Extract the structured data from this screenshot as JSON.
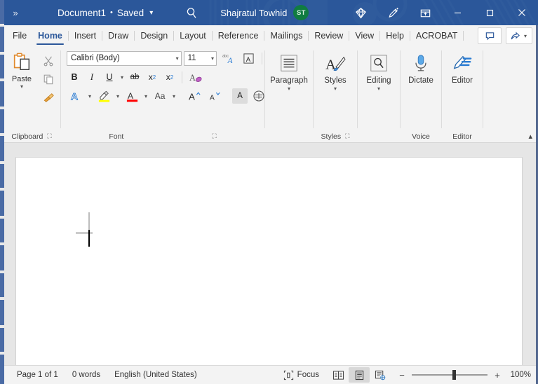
{
  "titlebar": {
    "expand_icon": "chevron-double-right-icon",
    "document_name": "Document1",
    "separator": "•",
    "saved_state": "Saved",
    "dropdown_icon": "chevron-down-icon",
    "search_icon": "search-icon",
    "user_name": "Shajratul Towhid",
    "avatar_initials": "ST",
    "avatar_color": "#107c41",
    "copilot_icon": "diamond-icon",
    "designer_icon": "pen-sparkle-icon",
    "ribbon_display_icon": "ribbon-display-options-icon",
    "minimize_icon": "minimize-icon",
    "maximize_icon": "maximize-icon",
    "close_icon": "close-icon",
    "bg_color": "#2b579a"
  },
  "tabs": [
    {
      "label": "File",
      "active": false
    },
    {
      "label": "Home",
      "active": true
    },
    {
      "label": "Insert",
      "active": false
    },
    {
      "label": "Draw",
      "active": false
    },
    {
      "label": "Design",
      "active": false
    },
    {
      "label": "Layout",
      "active": false
    },
    {
      "label": "Reference",
      "active": false
    },
    {
      "label": "Mailings",
      "active": false
    },
    {
      "label": "Review",
      "active": false
    },
    {
      "label": "View",
      "active": false
    },
    {
      "label": "Help",
      "active": false
    },
    {
      "label": "ACROBAT",
      "active": false
    }
  ],
  "tabbar_right": {
    "comments_icon": "comment-icon",
    "share_icon": "share-icon",
    "share_dropdown_icon": "chevron-down-icon"
  },
  "ribbon": {
    "active_tab_accent": "#2b579a",
    "clipboard": {
      "group_label": "Clipboard",
      "launcher_icon": "dialog-launcher-icon",
      "paste_label": "Paste",
      "paste_dropdown_icon": "chevron-down-icon",
      "cut_icon": "scissors-icon",
      "copy_icon": "copy-icon",
      "format_painter_icon": "format-painter-icon"
    },
    "font": {
      "group_label": "Font",
      "launcher_icon": "dialog-launcher-icon",
      "font_name": "Calibri (Body)",
      "font_size": "11",
      "font_name_dropdown_icon": "chevron-down-icon",
      "font_size_dropdown_icon": "chevron-down-icon",
      "phonetic_guide_icon": "phonetic-guide-icon",
      "character_border_icon": "character-border-icon",
      "bold_label": "B",
      "italic_label": "I",
      "underline_label": "U",
      "underline_dropdown_icon": "chevron-down-icon",
      "strikethrough_label": "ab",
      "subscript_label": "x",
      "subscript_sub": "2",
      "superscript_label": "x",
      "superscript_sup": "2",
      "clear_formatting_icon": "clear-formatting-icon",
      "text_effects_label": "A",
      "text_effects_dropdown_icon": "chevron-down-icon",
      "highlight_icon": "highlighter-icon",
      "highlight_color": "#ffff00",
      "highlight_dropdown_icon": "chevron-down-icon",
      "font_color_label": "A",
      "font_color": "#ff0000",
      "font_color_dropdown_icon": "chevron-down-icon",
      "change_case_label": "Aa",
      "change_case_dropdown_icon": "chevron-down-icon",
      "grow_font_label": "A",
      "shrink_font_label": "A",
      "text_highlight_label": "A",
      "character_shading_icon": "character-shading-icon"
    },
    "paragraph": {
      "label": "Paragraph",
      "icon": "paragraph-lines-icon",
      "dropdown_icon": "chevron-down-icon"
    },
    "styles": {
      "group_label": "Styles",
      "label": "Styles",
      "icon": "styles-brush-icon",
      "dropdown_icon": "chevron-down-icon",
      "launcher_icon": "dialog-launcher-icon"
    },
    "editing": {
      "label": "Editing",
      "icon": "magnifier-icon",
      "dropdown_icon": "chevron-down-icon"
    },
    "voice": {
      "group_label": "Voice",
      "label": "Dictate",
      "icon": "microphone-icon"
    },
    "editor": {
      "group_label": "Editor",
      "label": "Editor",
      "icon": "editor-pen-icon"
    },
    "collapse_ribbon_icon": "chevron-up-icon"
  },
  "document": {
    "page_background": "#ffffff",
    "canvas_background": "#e6e6e6",
    "caret": "text-caret",
    "cursor": "i-beam-cursor"
  },
  "statusbar": {
    "page_info": "Page 1 of 1",
    "word_count": "0 words",
    "language": "English (United States)",
    "focus_icon": "focus-mode-icon",
    "focus_label": "Focus",
    "read_mode_icon": "read-mode-icon",
    "print_layout_icon": "print-layout-icon",
    "web_layout_icon": "web-layout-icon",
    "zoom_out_label": "−",
    "zoom_in_label": "+",
    "zoom_value": "100%"
  }
}
